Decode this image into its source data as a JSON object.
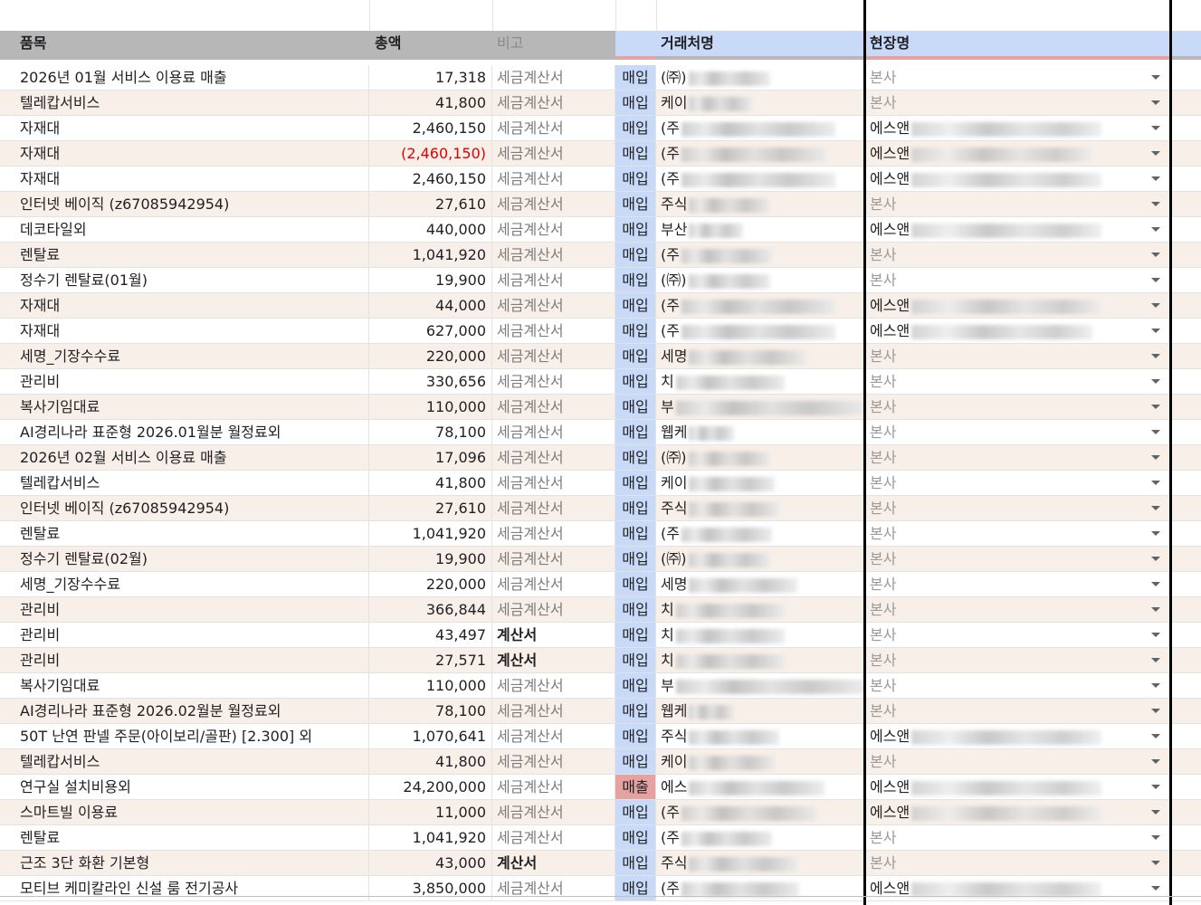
{
  "header": {
    "item": "품목",
    "amount": "총액",
    "note": "비고",
    "type": "",
    "vendor": "거래처명",
    "site": "현장명"
  },
  "rows": [
    {
      "item": "2026년 01월 서비스 이용료 매출",
      "amount": "17,318",
      "note": "세금계산서",
      "type": "매입",
      "vendor": "(㈜)",
      "site": "본사"
    },
    {
      "item": "텔레캅서비스",
      "amount": "41,800",
      "note": "세금계산서",
      "type": "매입",
      "vendor": "케이",
      "site": "본사"
    },
    {
      "item": "자재대",
      "amount": "2,460,150",
      "note": "세금계산서",
      "type": "매입",
      "vendor": "(주",
      "site": "에스앤"
    },
    {
      "item": "자재대",
      "amount": "(2,460,150)",
      "note": "세금계산서",
      "type": "매입",
      "vendor": "(주",
      "site": "에스앤"
    },
    {
      "item": "자재대",
      "amount": "2,460,150",
      "note": "세금계산서",
      "type": "매입",
      "vendor": "(주",
      "site": "에스앤"
    },
    {
      "item": "인터넷 베이직 (z67085942954)",
      "amount": "27,610",
      "note": "세금계산서",
      "type": "매입",
      "vendor": "주식",
      "site": "본사"
    },
    {
      "item": "데코타일외",
      "amount": "440,000",
      "note": "세금계산서",
      "type": "매입",
      "vendor": "부산",
      "site": "에스앤"
    },
    {
      "item": "렌탈료",
      "amount": "1,041,920",
      "note": "세금계산서",
      "type": "매입",
      "vendor": "(주",
      "site": "본사"
    },
    {
      "item": "정수기 렌탈료(01월)",
      "amount": "19,900",
      "note": "세금계산서",
      "type": "매입",
      "vendor": "(㈜)",
      "site": "본사"
    },
    {
      "item": "자재대",
      "amount": "44,000",
      "note": "세금계산서",
      "type": "매입",
      "vendor": "(주",
      "site": "에스앤"
    },
    {
      "item": "자재대",
      "amount": "627,000",
      "note": "세금계산서",
      "type": "매입",
      "vendor": "(주",
      "site": "에스앤"
    },
    {
      "item": "세명_기장수수료",
      "amount": "220,000",
      "note": "세금계산서",
      "type": "매입",
      "vendor": "세명",
      "site": "본사"
    },
    {
      "item": "관리비",
      "amount": "330,656",
      "note": "세금계산서",
      "type": "매입",
      "vendor": "치",
      "site": "본사"
    },
    {
      "item": "복사기임대료",
      "amount": "110,000",
      "note": "세금계산서",
      "type": "매입",
      "vendor": "부",
      "site": "본사"
    },
    {
      "item": "AI경리나라 표준형 2026.01월분 월정료외",
      "amount": "78,100",
      "note": "세금계산서",
      "type": "매입",
      "vendor": "웹케",
      "site": "본사"
    },
    {
      "item": "2026년 02월 서비스 이용료 매출",
      "amount": "17,096",
      "note": "세금계산서",
      "type": "매입",
      "vendor": "(㈜)",
      "site": "본사"
    },
    {
      "item": "텔레캅서비스",
      "amount": "41,800",
      "note": "세금계산서",
      "type": "매입",
      "vendor": "케이",
      "site": "본사"
    },
    {
      "item": "인터넷 베이직 (z67085942954)",
      "amount": "27,610",
      "note": "세금계산서",
      "type": "매입",
      "vendor": "주식",
      "site": "본사"
    },
    {
      "item": "렌탈료",
      "amount": "1,041,920",
      "note": "세금계산서",
      "type": "매입",
      "vendor": "(주",
      "site": "본사"
    },
    {
      "item": "정수기 렌탈료(02월)",
      "amount": "19,900",
      "note": "세금계산서",
      "type": "매입",
      "vendor": "(㈜)",
      "site": "본사"
    },
    {
      "item": "세명_기장수수료",
      "amount": "220,000",
      "note": "세금계산서",
      "type": "매입",
      "vendor": "세명",
      "site": "본사"
    },
    {
      "item": "관리비",
      "amount": "366,844",
      "note": "세금계산서",
      "type": "매입",
      "vendor": "치",
      "site": "본사"
    },
    {
      "item": "관리비",
      "amount": "43,497",
      "note": "계산서",
      "type": "매입",
      "vendor": "치",
      "site": "본사"
    },
    {
      "item": "관리비",
      "amount": "27,571",
      "note": "계산서",
      "type": "매입",
      "vendor": "치",
      "site": "본사"
    },
    {
      "item": "복사기임대료",
      "amount": "110,000",
      "note": "세금계산서",
      "type": "매입",
      "vendor": "부",
      "site": "본사"
    },
    {
      "item": "AI경리나라 표준형 2026.02월분 월정료외",
      "amount": "78,100",
      "note": "세금계산서",
      "type": "매입",
      "vendor": "웹케",
      "site": "본사"
    },
    {
      "item": "50T 난연 판넬 주문(아이보리/골판) [2.300] 외",
      "amount": "1,070,641",
      "note": "세금계산서",
      "type": "매입",
      "vendor": "주식",
      "site": "에스앤"
    },
    {
      "item": "텔레캅서비스",
      "amount": "41,800",
      "note": "세금계산서",
      "type": "매입",
      "vendor": "케이",
      "site": "본사"
    },
    {
      "item": "연구실 설치비용외",
      "amount": "24,200,000",
      "note": "세금계산서",
      "type": "매출",
      "vendor": "에스",
      "site": "에스앤"
    },
    {
      "item": "스마트빌 이용료",
      "amount": "11,000",
      "note": "세금계산서",
      "type": "매입",
      "vendor": "(주",
      "site": "에스앤"
    },
    {
      "item": "렌탈료",
      "amount": "1,041,920",
      "note": "세금계산서",
      "type": "매입",
      "vendor": "(주",
      "site": "본사"
    },
    {
      "item": "근조 3단 화환 기본형",
      "amount": "43,000",
      "note": "계산서",
      "type": "매입",
      "vendor": "주식",
      "site": "본사"
    },
    {
      "item": "모티브 케미칼라인 신설 룸 전기공사",
      "amount": "3,850,000",
      "note": "세금계산서",
      "type": "매입",
      "vendor": "(주",
      "site": "에스앤"
    }
  ]
}
